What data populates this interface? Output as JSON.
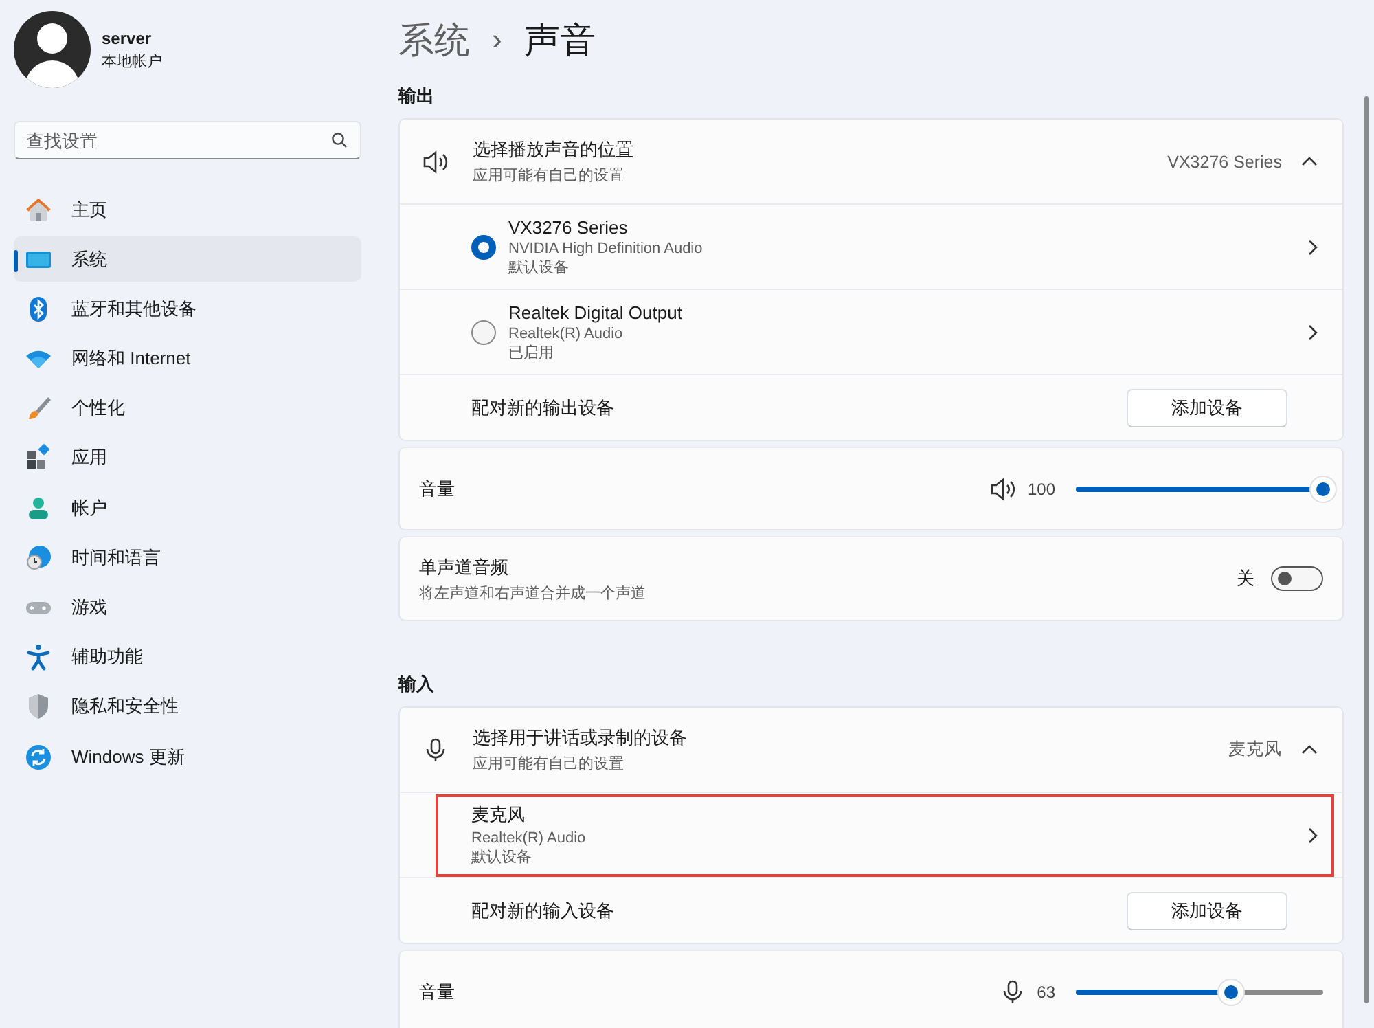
{
  "user": {
    "name": "server",
    "account_type": "本地帐户"
  },
  "search": {
    "placeholder": "查找设置"
  },
  "nav": [
    {
      "label": "主页",
      "selected": false
    },
    {
      "label": "系统",
      "selected": true
    },
    {
      "label": "蓝牙和其他设备",
      "selected": false
    },
    {
      "label": "网络和 Internet",
      "selected": false
    },
    {
      "label": "个性化",
      "selected": false
    },
    {
      "label": "应用",
      "selected": false
    },
    {
      "label": "帐户",
      "selected": false
    },
    {
      "label": "时间和语言",
      "selected": false
    },
    {
      "label": "游戏",
      "selected": false
    },
    {
      "label": "辅助功能",
      "selected": false
    },
    {
      "label": "隐私和安全性",
      "selected": false
    },
    {
      "label": "Windows 更新",
      "selected": false
    }
  ],
  "breadcrumb": {
    "parent": "系统",
    "separator": "›",
    "current": "声音"
  },
  "sections": [
    {
      "heading": "输出",
      "kind": "speaker",
      "picker": {
        "title": "选择播放声音的位置",
        "subtitle": "应用可能有自己的设置",
        "current": "VX3276 Series",
        "expanded": true
      },
      "devices": [
        {
          "name": "VX3276 Series",
          "driver": "NVIDIA High Definition Audio",
          "status": "默认设备",
          "selected": true,
          "highlighted": false
        },
        {
          "name": "Realtek Digital Output",
          "driver": "Realtek(R) Audio",
          "status": "已启用",
          "selected": false,
          "highlighted": false
        }
      ],
      "pair": {
        "label": "配对新的输出设备",
        "button": "添加设备"
      },
      "volume": {
        "label": "音量",
        "reading": "100",
        "level": 1
      },
      "mono": {
        "title": "单声道音频",
        "subtitle": "将左声道和右声道合并成一个声道",
        "state": "关",
        "on": false
      }
    },
    {
      "heading": "输入",
      "kind": "microphone",
      "picker": {
        "title": "选择用于讲话或录制的设备",
        "subtitle": "应用可能有自己的设置",
        "current": "麦克风",
        "expanded": true
      },
      "devices": [
        {
          "name": "麦克风",
          "driver": "Realtek(R) Audio",
          "status": "默认设备",
          "highlighted": true
        }
      ],
      "pair": {
        "label": "配对新的输入设备",
        "button": "添加设备"
      },
      "volume": {
        "label": "音量",
        "reading": "63",
        "level": 0.63
      }
    }
  ]
}
